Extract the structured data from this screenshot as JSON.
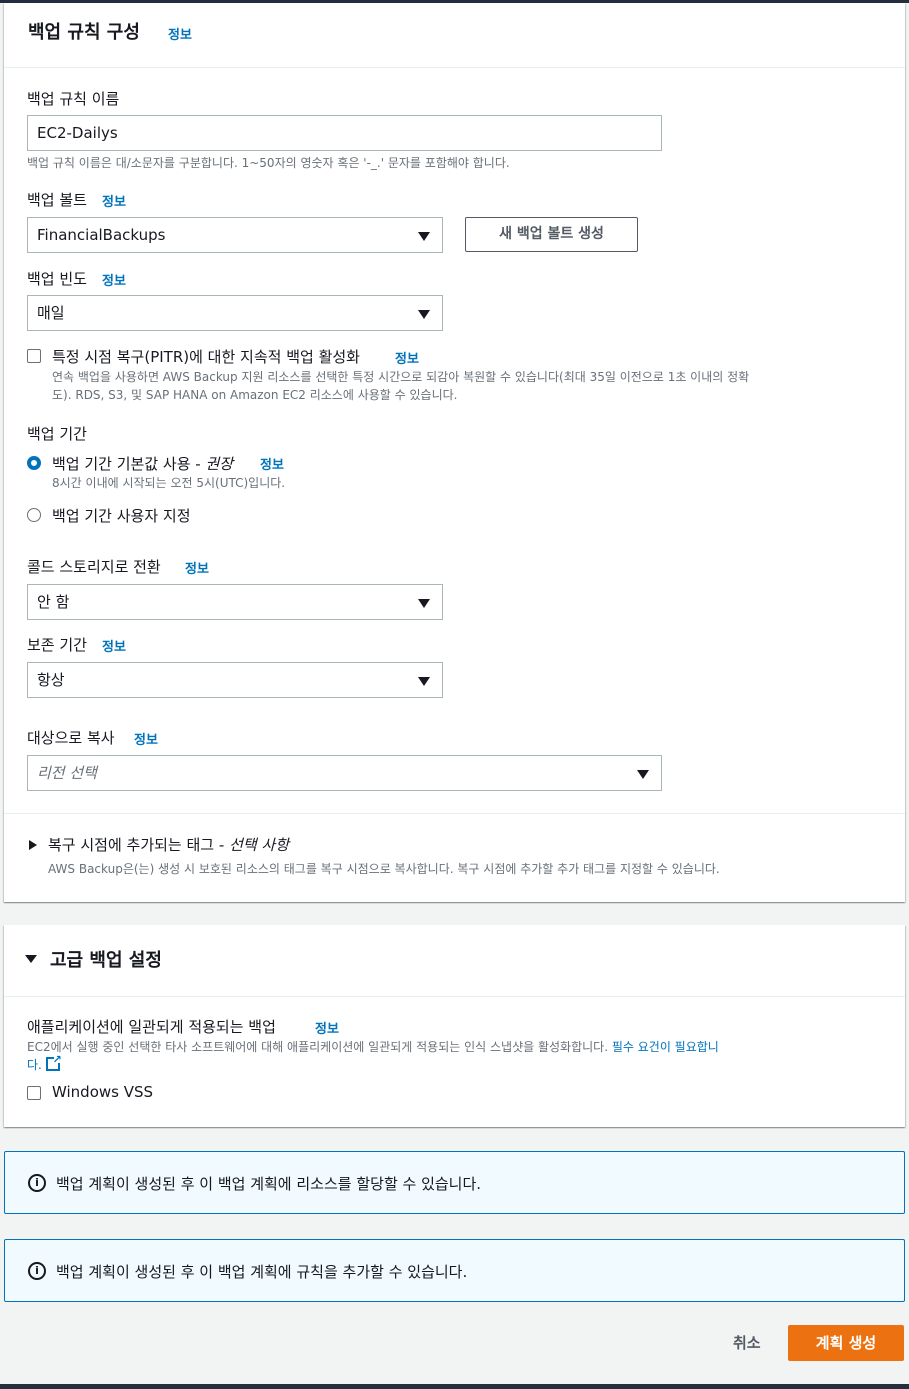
{
  "rule_section": {
    "title": "백업 규칙 구성",
    "info": "정보",
    "rule_name": {
      "label": "백업 규칙 이름",
      "value": "EC2-Dailys",
      "hint": "백업 규칙 이름은 대/소문자를 구분합니다. 1~50자의 영숫자 혹은 '-_.' 문자를 포함해야 합니다."
    },
    "vault": {
      "label": "백업 볼트",
      "info": "정보",
      "value": "FinancialBackups",
      "create_button": "새 백업 볼트 생성"
    },
    "frequency": {
      "label": "백업 빈도",
      "info": "정보",
      "value": "매일"
    },
    "pitr": {
      "label": "특정 시점 복구(PITR)에 대한 지속적 백업 활성화",
      "info": "정보",
      "desc_line1": "연속 백업을 사용하면 AWS Backup 지원 리소스를 선택한 특정 시간으로 되감아 복원할 수 있습니다(최대 35일 이전으로 1초 이내의 정확",
      "desc_line2": "도). RDS, S3, 및 SAP HANA on Amazon EC2 리소스에 사용할 수 있습니다.",
      "checked": false
    },
    "window": {
      "label": "백업 기간",
      "default_option_prefix": "백업 기간 기본값 사용 - ",
      "default_option_emph": "권장",
      "default_info": "정보",
      "default_desc": "8시간 이내에 시작되는 오전 5시(UTC)입니다.",
      "custom_option": "백업 기간 사용자 지정",
      "selected": "default"
    },
    "cold_storage": {
      "label": "콜드 스토리지로 전환",
      "info": "정보",
      "value": "안 함"
    },
    "retention": {
      "label": "보존 기간",
      "info": "정보",
      "value": "항상"
    },
    "copy": {
      "label": "대상으로 복사",
      "info": "정보",
      "placeholder": "리전 선택"
    },
    "tags": {
      "title_prefix": "복구 시점에 추가되는 태그 - ",
      "title_emph": "선택 사항",
      "desc": "AWS Backup은(는) 생성 시 보호된 리소스의 태그를 복구 시점으로 복사합니다. 복구 시점에 추가할 추가 태그를 지정할 수 있습니다."
    }
  },
  "advanced_section": {
    "title": "고급 백업 설정",
    "app_consistent": {
      "label": "애플리케이션에 일관되게 적용되는 백업",
      "info": "정보",
      "desc_part1": "EC2에서 실행 중인 선택한 타사 소프트웨어에 대해 애플리케이션에 일관되게 적용되는 인식 스냅샷을 활성화합니다. ",
      "desc_link1": "필수 요건이 필요합니",
      "desc_link2": "다.",
      "option": "Windows VSS",
      "checked": false
    }
  },
  "alerts": [
    {
      "text": "백업 계획이 생성된 후 이 백업 계획에 리소스를 할당할 수 있습니다."
    },
    {
      "text": "백업 계획이 생성된 후 이 백업 계획에 규칙을 추가할 수 있습니다."
    }
  ],
  "footer": {
    "cancel": "취소",
    "create": "계획 생성"
  },
  "colors": {
    "link": "#0073bb",
    "primary": "#ec7211",
    "info_bg": "#f1faff"
  }
}
